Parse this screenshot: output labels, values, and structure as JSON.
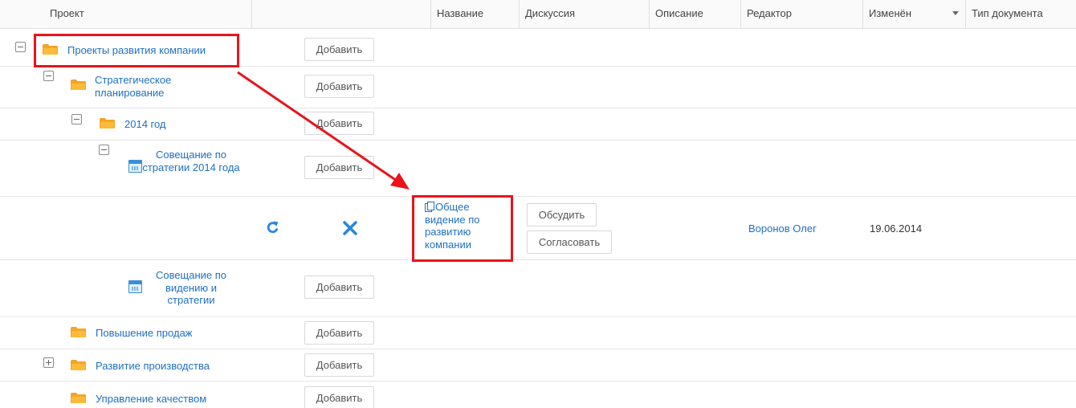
{
  "header": {
    "project": "Проект",
    "name": "Название",
    "discussion": "Дискуссия",
    "description": "Описание",
    "editor": "Редактор",
    "changed": "Изменён",
    "doc_type": "Тип документа"
  },
  "tree": {
    "root": "Проекты развития компании",
    "strategic": "Стратегическое планирование",
    "year2014": "2014 год",
    "meeting1": "Совещание по стратегии 2014 года",
    "meeting2": "Совещание по видению и стратегии",
    "sales": "Повышение продаж",
    "production": "Развитие производства",
    "quality": "Управление качеством"
  },
  "buttons": {
    "add": "Добавить",
    "discuss": "Обсудить",
    "approve": "Согласовать"
  },
  "document": {
    "name": "Общее видение по развитию компании",
    "editor": "Воронов Олег",
    "changed": "19.06.2014"
  },
  "colors": {
    "link": "#1f6fc4",
    "highlight": "#e8141b",
    "folder": "#f5a623",
    "icon_blue": "#2a86e0"
  },
  "icons": {
    "refresh": "refresh-icon",
    "delete": "close-icon",
    "folder": "folder-icon",
    "calendar": "calendar-icon",
    "document": "document-icon"
  }
}
